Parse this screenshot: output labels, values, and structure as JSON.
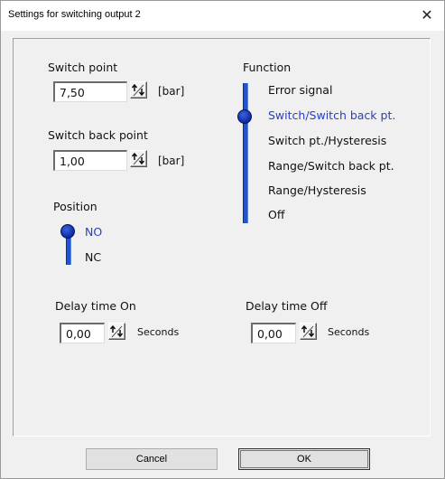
{
  "window": {
    "title": "Settings for switching output 2"
  },
  "switch_point": {
    "label": "Switch point",
    "value": "7,50",
    "unit": "[bar]"
  },
  "switch_back_point": {
    "label": "Switch back point",
    "value": "1,00",
    "unit": "[bar]"
  },
  "position": {
    "label": "Position",
    "options": [
      "NO",
      "NC"
    ],
    "selected": "NO"
  },
  "function": {
    "label": "Function",
    "options": [
      "Error signal",
      "Switch/Switch back pt.",
      "Switch pt./Hysteresis",
      "Range/Switch back pt.",
      "Range/Hysteresis",
      "Off"
    ],
    "selected": "Switch/Switch back pt."
  },
  "delay_on": {
    "label": "Delay time On",
    "value": "0,00",
    "unit": "Seconds"
  },
  "delay_off": {
    "label": "Delay time Off",
    "value": "0,00",
    "unit": "Seconds"
  },
  "buttons": {
    "cancel": "Cancel",
    "ok": "OK"
  },
  "colors": {
    "accent": "#2255cc",
    "selected_text": "#2a3fc2"
  }
}
